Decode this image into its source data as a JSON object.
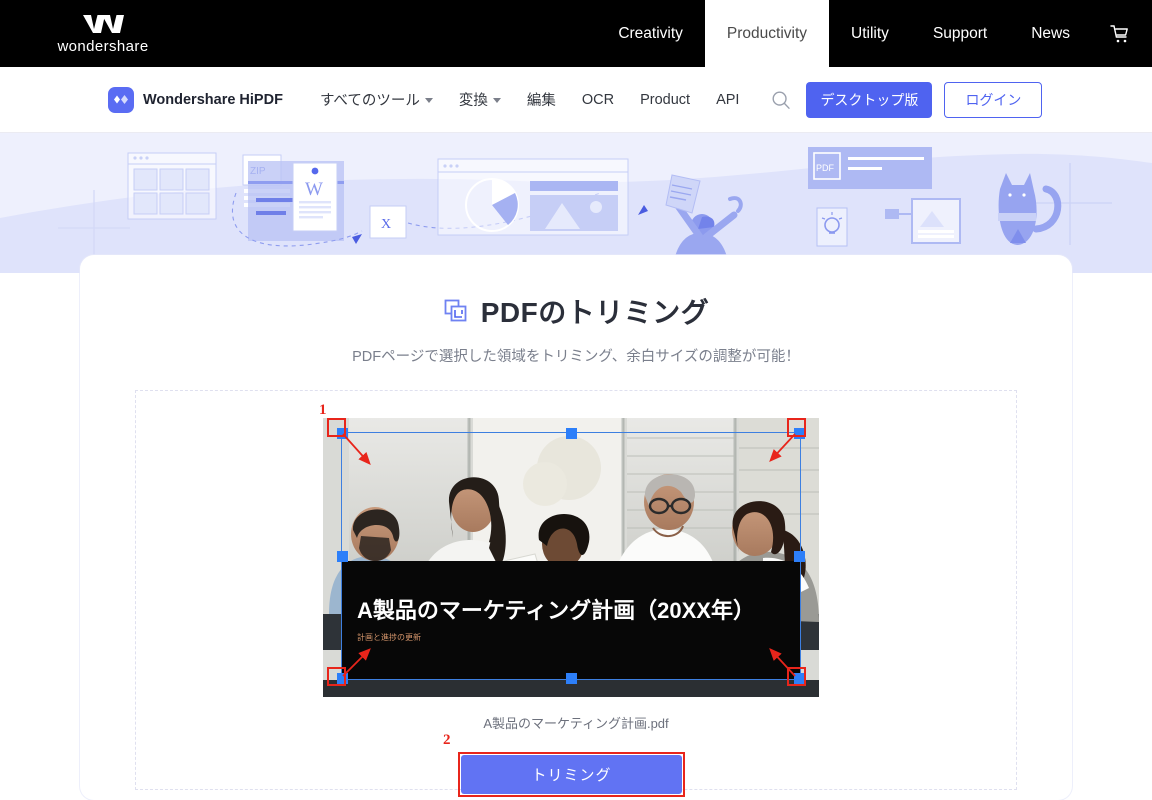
{
  "topbar": {
    "brand_name": "wondershare",
    "brand_logo_icon": "wondershare-w-logo",
    "nav": [
      {
        "label": "Creativity",
        "active": false
      },
      {
        "label": "Productivity",
        "active": true
      },
      {
        "label": "Utility",
        "active": false
      },
      {
        "label": "Support",
        "active": false
      },
      {
        "label": "News",
        "active": false
      }
    ],
    "cart_icon": "shopping-cart-icon"
  },
  "subbar": {
    "logo_icon": "hipdf-diamond-icon",
    "logo_text": "Wondershare HiPDF",
    "nav": [
      {
        "label": "すべてのツール",
        "has_caret": true
      },
      {
        "label": "変換",
        "has_caret": true
      },
      {
        "label": "編集",
        "has_caret": false
      },
      {
        "label": "OCR",
        "has_caret": false
      },
      {
        "label": "Product",
        "has_caret": false
      },
      {
        "label": "API",
        "has_caret": false
      }
    ],
    "search_icon": "search-icon",
    "desktop_button": "デスクトップ版",
    "login_button": "ログイン"
  },
  "hero": {
    "labels": {
      "zip": "ZIP",
      "word": "W",
      "excel": "X",
      "pdf": "PDF"
    }
  },
  "main": {
    "title_icon": "crop-icon",
    "title": "PDFのトリミング",
    "subtitle": "PDFページで選択した領域をトリミング、余白サイズの調整が可能！",
    "filename": "A製品のマーケティング計画.pdf",
    "submit_button": "トリミング",
    "preview": {
      "slide_title": "A製品のマーケティング計画（20XX年）",
      "slide_subtitle": "計画と進捗の更新"
    }
  },
  "annotations": [
    {
      "number": "1",
      "target": "crop-handle-top-left"
    },
    {
      "number": "2",
      "target": "trim-button"
    }
  ],
  "colors": {
    "topbar_bg": "#000000",
    "accent_blue": "#4f63f0",
    "button_blue": "#6173f3",
    "hero_bg": "#eef0fd",
    "annotation_red": "#e8251b",
    "handle_blue": "#2d7ff9"
  }
}
